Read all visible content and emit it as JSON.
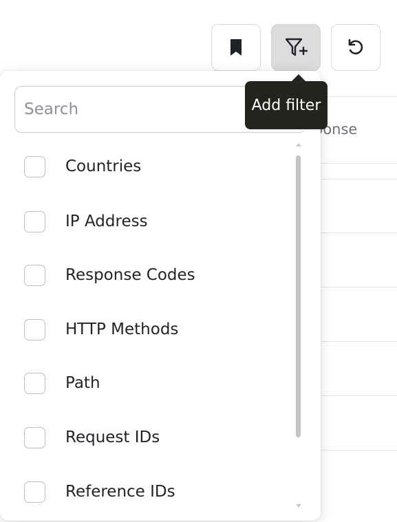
{
  "toolbar": {
    "bookmark_icon": "bookmark-icon",
    "filter_icon": "filter-add-icon",
    "reset_icon": "undo-icon",
    "filter_button_state": "active"
  },
  "tooltip": {
    "text": "Add filter"
  },
  "background_table": {
    "header_fragment": "ponse"
  },
  "dropdown": {
    "search": {
      "placeholder": "Search",
      "value": ""
    },
    "items": [
      {
        "label": "Countries",
        "checked": false
      },
      {
        "label": "IP Address",
        "checked": false
      },
      {
        "label": "Response Codes",
        "checked": false
      },
      {
        "label": "HTTP Methods",
        "checked": false
      },
      {
        "label": "Path",
        "checked": false
      },
      {
        "label": "Request IDs",
        "checked": false
      },
      {
        "label": "Reference IDs",
        "checked": false
      }
    ]
  },
  "colors": {
    "tooltip_bg": "#23241f",
    "active_button_bg": "#dcdcde",
    "text": "#1f2328",
    "muted_text": "#6b7079"
  }
}
